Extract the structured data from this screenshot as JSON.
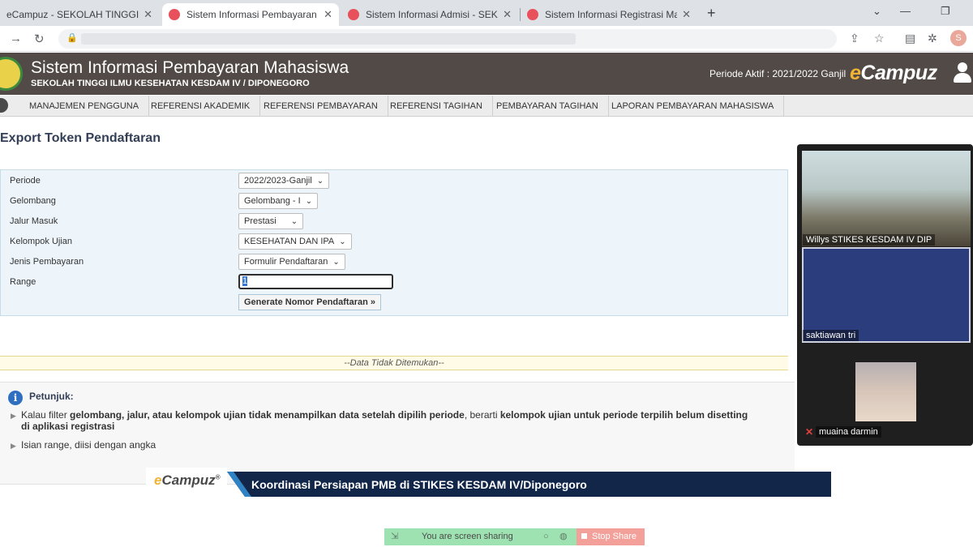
{
  "browser": {
    "tabs": [
      {
        "title": "eCampuz - SEKOLAH TINGGI ILMU KESEHATAN KESDAM IV/DIPONEGORO",
        "active": false
      },
      {
        "title": "Sistem Informasi Pembayaran Mahasiswa",
        "active": true
      },
      {
        "title": "Sistem Informasi Admisi - SEKOLAH TINGGI",
        "active": false
      },
      {
        "title": "Sistem Informasi Registrasi Mahasiswa",
        "active": false
      }
    ],
    "profile_initial": "S"
  },
  "header": {
    "title": "Sistem Informasi Pembayaran Mahasiswa",
    "subtitle": "SEKOLAH TINGGI ILMU KESEHATAN KESDAM IV / DIPONEGORO",
    "periode_aktif": "Periode Aktif : 2021/2022 Ganjil",
    "brand_prefix": "e",
    "brand_rest": "Campuz"
  },
  "menu": [
    "MANAJEMEN PENGGUNA",
    "REFERENSI AKADEMIK",
    "REFERENSI PEMBAYARAN",
    "REFERENSI TAGIHAN",
    "PEMBAYARAN TAGIHAN",
    "LAPORAN PEMBAYARAN MAHASISWA"
  ],
  "page": {
    "title": "Export Token Pendaftaran",
    "form": {
      "periode_label": "Periode",
      "periode_value": "2022/2023-Ganjil",
      "gelombang_label": "Gelombang",
      "gelombang_value": "Gelombang - I",
      "jalur_label": "Jalur Masuk",
      "jalur_value": "Prestasi",
      "kelompok_label": "Kelompok Ujian",
      "kelompok_value": "KESEHATAN DAN IPA",
      "jenis_label": "Jenis Pembayaran",
      "jenis_value": "Formulir Pendaftaran",
      "range_label": "Range",
      "range_value": "1",
      "generate_button": "Generate Nomor Pendaftaran »"
    },
    "result_text": "--Data Tidak Ditemukan--",
    "petunjuk": {
      "title": "Petunjuk:",
      "item1_a": "Kalau filter ",
      "item1_b": "gelombang, jalur, atau kelompok ujian tidak menampilkan data setelah dipilih periode",
      "item1_c": ", berarti ",
      "item1_d": "kelompok ujian untuk periode terpilih belum disetting di aplikasi registrasi",
      "item2": "Isian range, diisi dengan angka"
    }
  },
  "video": {
    "participant1": "Willys STIKES KESDAM IV DIP",
    "participant2": "saktiawan tri",
    "participant3": "muaina darmin"
  },
  "banner": {
    "logo_prefix": "e",
    "logo_rest": "Campuz",
    "logo_mark": "®",
    "text": "Koordinasi Persiapan PMB di STIKES KESDAM IV/Diponegoro"
  },
  "share": {
    "label": "You are screen sharing",
    "stop_label": "Stop Share"
  },
  "colors": {
    "header_bg": "#514a46",
    "brand_accent": "#f2b233",
    "form_panel_bg": "#edf5fb",
    "banner_bg": "#12264a",
    "share_bar": "#9fe2b2",
    "stop_share": "#f4a09a"
  }
}
